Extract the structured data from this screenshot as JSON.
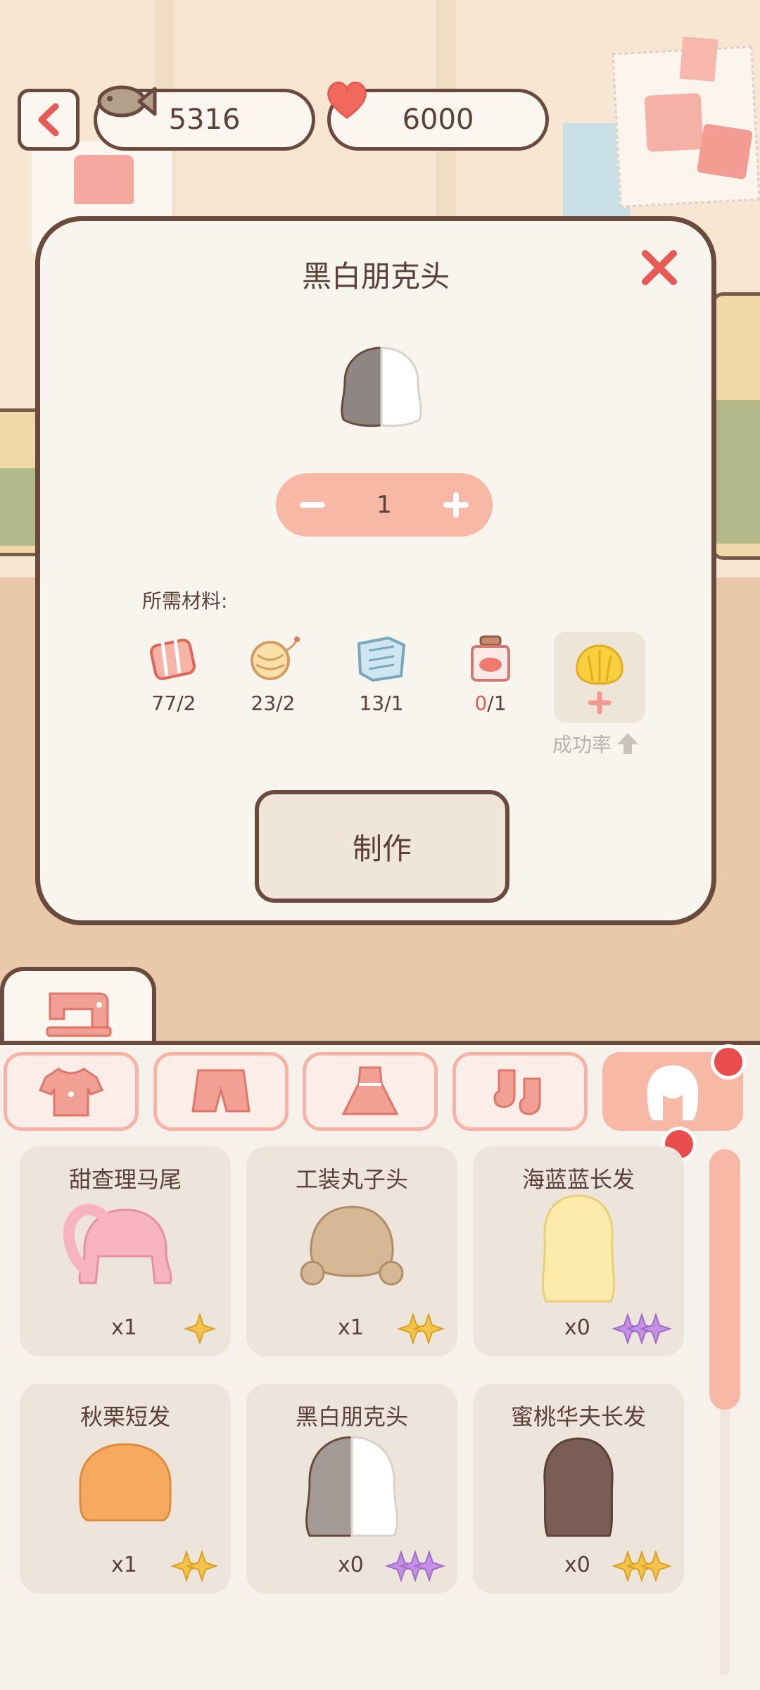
{
  "currency": {
    "fish": "5316",
    "hearts": "6000"
  },
  "modal": {
    "title": "黑白朋克头",
    "quantity": "1",
    "materials_label": "所需材料:",
    "materials": [
      {
        "icon": "fabric-roll-icon",
        "owned": "77",
        "need": "2",
        "short": false
      },
      {
        "icon": "yarn-ball-icon",
        "owned": "23",
        "need": "2",
        "short": false
      },
      {
        "icon": "cloth-sheet-icon",
        "owned": "13",
        "need": "1",
        "short": false
      },
      {
        "icon": "dye-jar-icon",
        "owned": "0",
        "need": "1",
        "short": true
      }
    ],
    "boost_label": "成功率",
    "make_label": "制作"
  },
  "categories": [
    {
      "icon": "shirt-icon",
      "active": false
    },
    {
      "icon": "shorts-icon",
      "active": false
    },
    {
      "icon": "dress-icon",
      "active": false
    },
    {
      "icon": "socks-icon",
      "active": false
    },
    {
      "icon": "hair-icon",
      "active": true
    }
  ],
  "items": [
    {
      "name": "甜查理马尾",
      "count": "x1",
      "stars": 1,
      "color": "#f7b3c0",
      "star_color": "#f6c34a"
    },
    {
      "name": "工装丸子头",
      "count": "x1",
      "stars": 2,
      "color": "#d6b896",
      "star_color": "#f6c34a"
    },
    {
      "name": "海蓝蓝长发",
      "count": "x0",
      "stars": 3,
      "color": "#fbeaaa",
      "star_color": "#c58fe6"
    },
    {
      "name": "秋栗短发",
      "count": "x1",
      "stars": 2,
      "color": "#f6aa5f",
      "star_color": "#f6c34a"
    },
    {
      "name": "黑白朋克头",
      "count": "x0",
      "stars": 3,
      "color": "#a49a95",
      "star_color": "#c58fe6"
    },
    {
      "name": "蜜桃华夫长发",
      "count": "x0",
      "stars": 3,
      "color": "#7a5e55",
      "star_color": "#f6c34a"
    }
  ]
}
